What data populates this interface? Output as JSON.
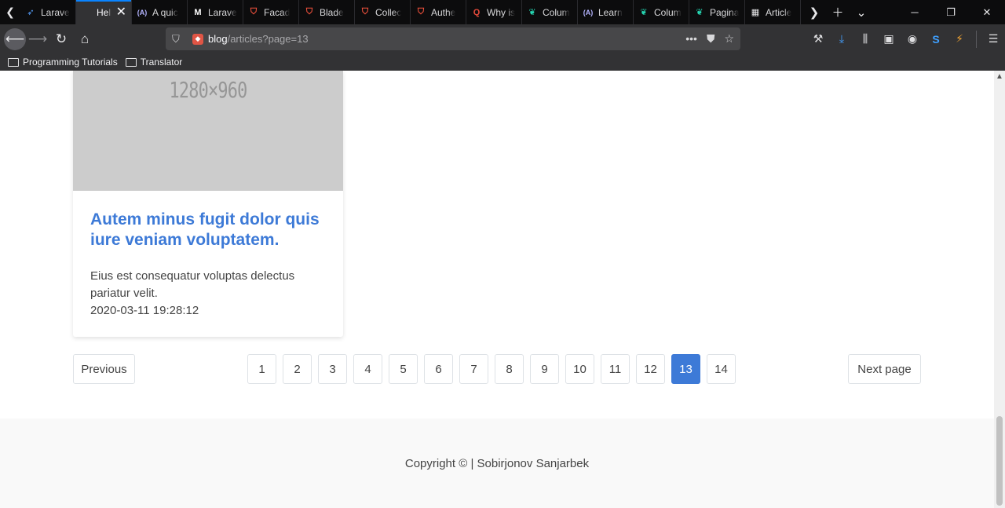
{
  "tabs": [
    {
      "title": "Larave",
      "icon": "laravel-blue-icon",
      "color": "#56a0ff",
      "glyph": "➶"
    },
    {
      "title": "Hello B",
      "icon": "blank-page-icon",
      "color": "#ffffff",
      "glyph": "",
      "active": true
    },
    {
      "title": "A quic",
      "icon": "angular-icon",
      "color": "#b4b4ff",
      "glyph": "(A)"
    },
    {
      "title": "Larave",
      "icon": "medium-icon",
      "color": "#ffffff",
      "glyph": "M"
    },
    {
      "title": "Facad",
      "icon": "laravel-icon",
      "color": "#f0513c",
      "glyph": "⛉"
    },
    {
      "title": "Blade",
      "icon": "laravel-icon",
      "color": "#f0513c",
      "glyph": "⛉"
    },
    {
      "title": "Collec",
      "icon": "laravel-icon",
      "color": "#f0513c",
      "glyph": "⛉"
    },
    {
      "title": "Authe",
      "icon": "laravel-icon",
      "color": "#f0513c",
      "glyph": "⛉"
    },
    {
      "title": "Why is",
      "icon": "quora-icon",
      "color": "#e64a3b",
      "glyph": "Q"
    },
    {
      "title": "Colum",
      "icon": "bootstrap-leaf-icon",
      "color": "#26d6b2",
      "glyph": "❦"
    },
    {
      "title": "Learn",
      "icon": "angular-icon",
      "color": "#b4b4ff",
      "glyph": "(A)"
    },
    {
      "title": "Colum",
      "icon": "bootstrap-leaf-icon",
      "color": "#26d6b2",
      "glyph": "❦"
    },
    {
      "title": "Pagina",
      "icon": "bootstrap-leaf-icon",
      "color": "#26d6b2",
      "glyph": "❦"
    },
    {
      "title": "Article",
      "icon": "grid-page-icon",
      "color": "#e8e8ea",
      "glyph": "▦"
    }
  ],
  "address": {
    "host": "blog",
    "path": "/articles?page=13"
  },
  "bookmarks": [
    {
      "label": "Programming Tutorials"
    },
    {
      "label": "Translator"
    }
  ],
  "article": {
    "image_placeholder": "1280×960",
    "title": "Autem minus fugit dolor quis iure veniam voluptatem.",
    "excerpt": "Eius est consequatur voluptas delectus pariatur velit.",
    "date": "2020-03-11 19:28:12"
  },
  "pagination": {
    "previous_label": "Previous",
    "next_label": "Next page",
    "pages": [
      "1",
      "2",
      "3",
      "4",
      "5",
      "6",
      "7",
      "8",
      "9",
      "10",
      "11",
      "12",
      "13",
      "14"
    ],
    "current": "13"
  },
  "footer": {
    "copyright": "Copyright © | Sobirjonov Sanjarbek"
  },
  "colors": {
    "accent": "#3d7ad7",
    "chrome_dark": "#0c0c0d",
    "chrome_toolbar": "#323234"
  }
}
